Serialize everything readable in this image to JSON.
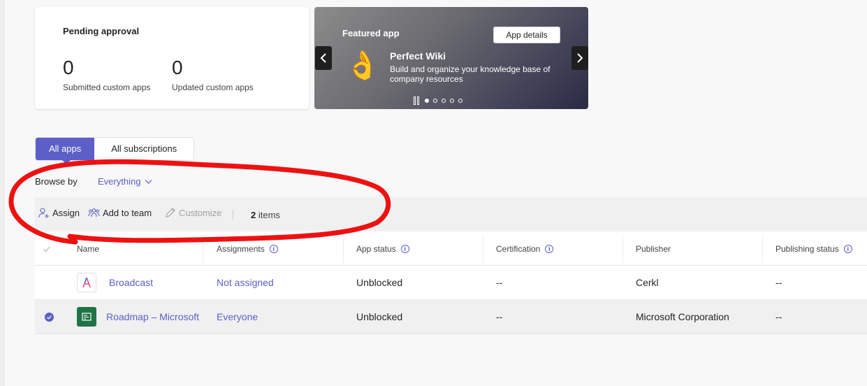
{
  "pending": {
    "title": "Pending approval",
    "submitted_count": "0",
    "submitted_label": "Submitted custom apps",
    "updated_count": "0",
    "updated_label": "Updated custom apps"
  },
  "featured": {
    "label": "Featured app",
    "details_button": "App details",
    "app_icon": "ok-hand-icon",
    "app_name": "Perfect Wiki",
    "app_description": "Build and organize your knowledge base of company resources",
    "slides_total": 5,
    "active_slide": 1
  },
  "tabs": [
    {
      "label": "All apps",
      "active": true
    },
    {
      "label": "All subscriptions",
      "active": false
    }
  ],
  "browse": {
    "label": "Browse by",
    "value": "Everything"
  },
  "toolbar": {
    "assign": "Assign",
    "add_to_team": "Add to team",
    "customize": "Customize",
    "count_number": "2",
    "count_suffix": "items"
  },
  "table": {
    "columns": [
      "Name",
      "Assignments",
      "App status",
      "Certification",
      "Publisher",
      "Publishing status"
    ],
    "rows": [
      {
        "name": "Broadcast",
        "assignments": "Not assigned",
        "app_status": "Unblocked",
        "certification": "--",
        "publisher": "Cerkl",
        "publishing_status": "--",
        "selected": false
      },
      {
        "name": "Roadmap – Microsoft",
        "assignments": "Everyone",
        "app_status": "Unblocked",
        "certification": "--",
        "publisher": "Microsoft Corporation",
        "publishing_status": "--",
        "selected": true
      }
    ]
  },
  "colors": {
    "accent": "#5b5fc7",
    "annotation": "#ee1111",
    "roadmap_icon": "#217346"
  }
}
